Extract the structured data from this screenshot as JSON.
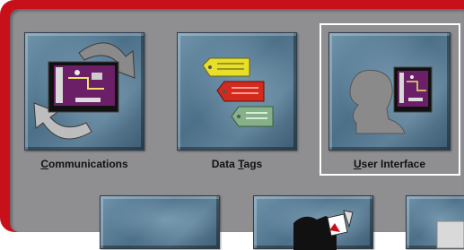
{
  "window": {
    "frame_color": "#c8101b",
    "panel_color": "#8f8f92",
    "selection_color": "#ffffff"
  },
  "tiles": [
    {
      "id": "communications",
      "label_acc": "C",
      "label_rest": "ommunications",
      "icon": "communications-icon"
    },
    {
      "id": "data-tags",
      "label_pre": "Data ",
      "label_acc": "T",
      "label_rest": "ags",
      "icon": "data-tags-icon"
    },
    {
      "id": "user-interface",
      "label_acc": "U",
      "label_rest": "ser Interface",
      "icon": "user-interface-icon",
      "selected": true
    }
  ],
  "partial_tiles": [
    {
      "icon": "tile-4-icon"
    },
    {
      "icon": "tile-5-icon"
    },
    {
      "icon": "tile-6-icon"
    }
  ]
}
